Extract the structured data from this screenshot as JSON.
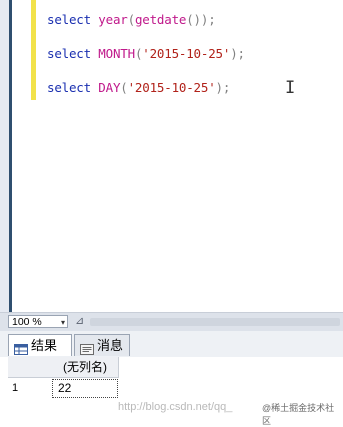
{
  "editor": {
    "lines": [
      {
        "kw": "select",
        "fn": "year",
        "p1": "(",
        "fn2": "getdate",
        "p2": "());"
      },
      {
        "kw": "select",
        "fn": "MONTH",
        "p1": "(",
        "str": "'2015-10-25'",
        "p2": ");"
      },
      {
        "kw": "select",
        "fn": "DAY",
        "p1": "(",
        "str": "'2015-10-25'",
        "p2": ");"
      }
    ],
    "cursor_glyph": "I"
  },
  "status": {
    "zoom": "100 %",
    "zoom_arrow": "▾",
    "pin_icon_glyph": "⊿"
  },
  "tabs": [
    {
      "label": "结果",
      "icon": "grid-icon"
    },
    {
      "label": "消息",
      "icon": "message-icon"
    }
  ],
  "grid": {
    "column_header": "(无列名)",
    "rows": [
      {
        "num": "1",
        "value": "22"
      }
    ]
  },
  "watermark": {
    "text": "http://blog.csdn.net/qq_",
    "badge": "@稀土掘金技术社区"
  }
}
